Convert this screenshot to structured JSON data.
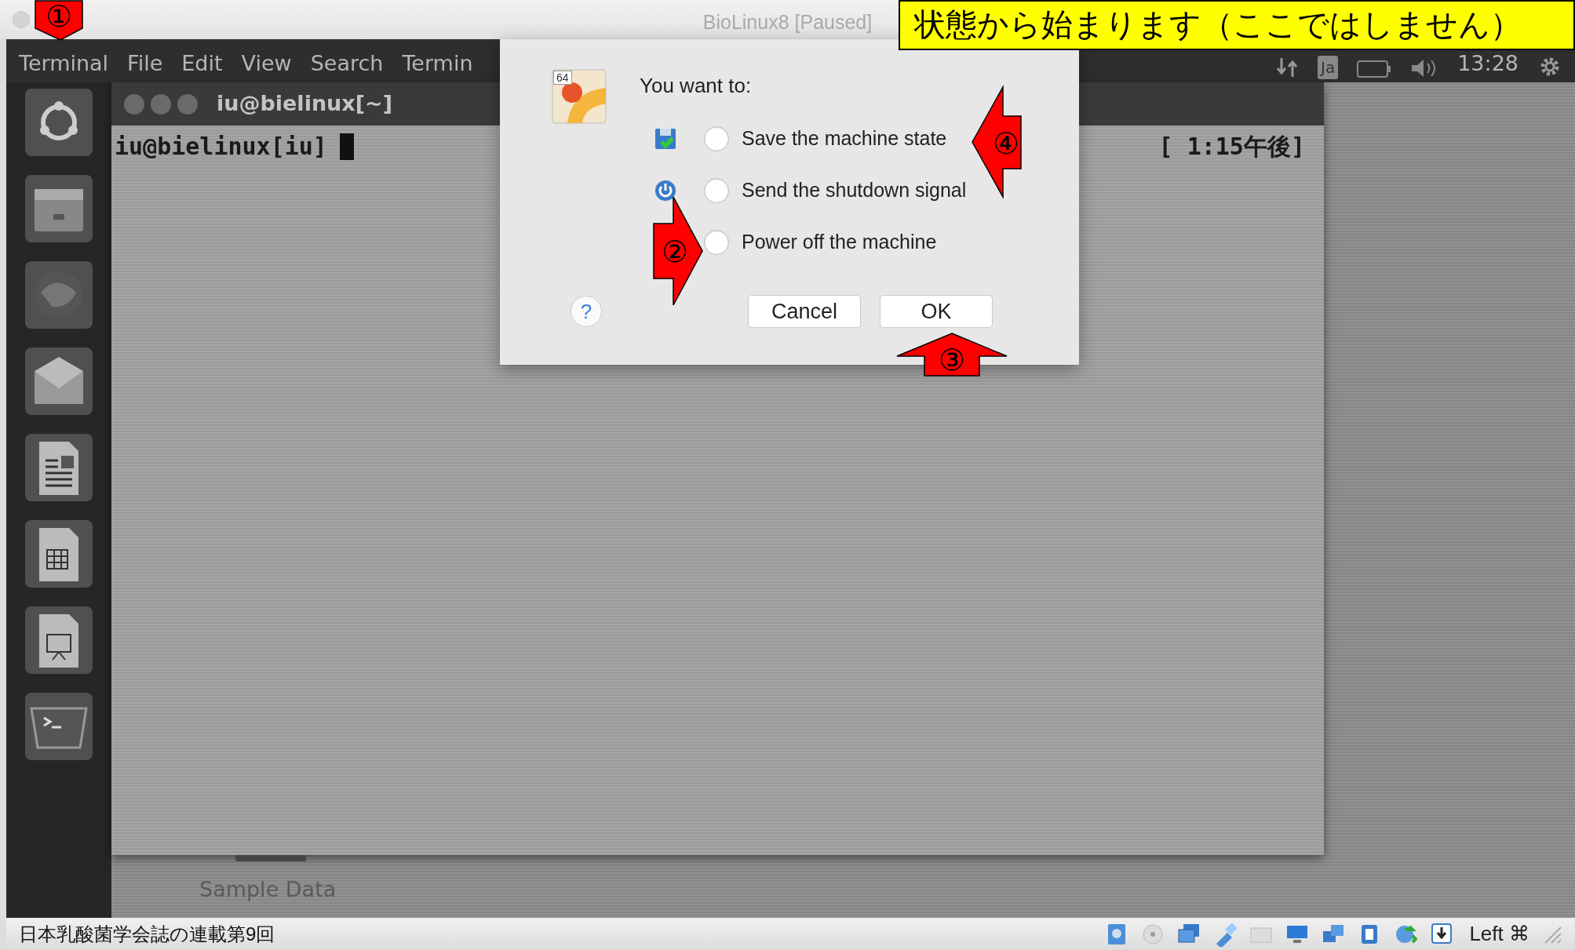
{
  "window": {
    "title": "BioLinux8 [Paused]"
  },
  "callout": {
    "text": "状態から始まります（ここではしません）"
  },
  "top_panel": {
    "menu": [
      "Terminal",
      "File",
      "Edit",
      "View",
      "Search",
      "Termin"
    ],
    "keyboard": "Ja",
    "clock": "13:28"
  },
  "terminal": {
    "title": "iu@bielinux[~]",
    "prompt": "iu@bielinux[iu]",
    "time": "[ 1:15午後]"
  },
  "desktop": {
    "folder_label": "Sample Data"
  },
  "dialog": {
    "heading": "You want to:",
    "options": [
      {
        "label": "Save the machine state",
        "selected": false,
        "kind": "save"
      },
      {
        "label": "Send the shutdown signal",
        "selected": false,
        "kind": "signal"
      },
      {
        "label": "Power off the machine",
        "selected": false,
        "kind": "poweroff"
      }
    ],
    "icon_badge": "64",
    "help": "?",
    "buttons": [
      "Cancel",
      "OK"
    ]
  },
  "annotations": [
    {
      "label": "①",
      "kind": "down"
    },
    {
      "label": "②",
      "kind": "right"
    },
    {
      "label": "③",
      "kind": "up"
    },
    {
      "label": "④",
      "kind": "left"
    }
  ],
  "status_bar": {
    "host_key": "Left ⌘"
  },
  "footer": {
    "text": "日本乳酸菌学会誌の連載第9回"
  }
}
